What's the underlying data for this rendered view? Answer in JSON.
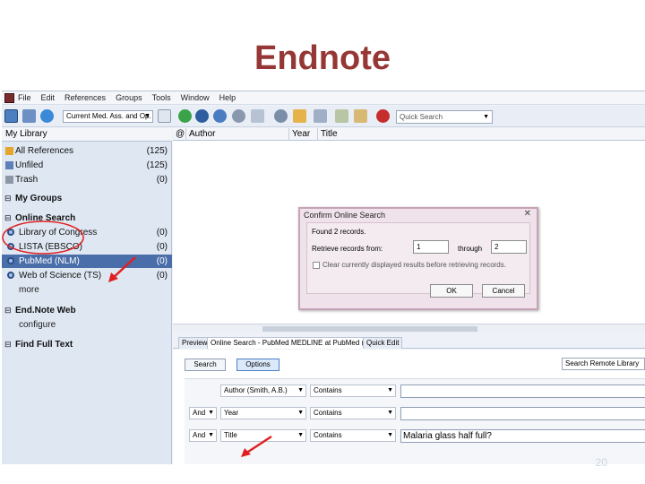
{
  "slide": {
    "title": "Endnote",
    "page_number": "20"
  },
  "menu": [
    "File",
    "Edit",
    "References",
    "Groups",
    "Tools",
    "Window",
    "Help"
  ],
  "toolbar": {
    "style_select": "Current Med. Ass. and Op. Ci.",
    "quick_search_placeholder": "Quick Search"
  },
  "left_pane": {
    "header": "My Library",
    "items": [
      {
        "label": "All References",
        "count": "(125)"
      },
      {
        "label": "Unfiled",
        "count": "(125)"
      },
      {
        "label": "Trash",
        "count": "(0)"
      }
    ],
    "my_groups": "My Groups",
    "online_search": {
      "title": "Online Search",
      "items": [
        {
          "label": "Library of Congress",
          "count": "(0)"
        },
        {
          "label": "LISTA (EBSCO)",
          "count": "(0)"
        },
        {
          "label": "PubMed (NLM)",
          "count": "(0)"
        },
        {
          "label": "Web of Science (TS)",
          "count": "(0)"
        }
      ],
      "more": "more"
    },
    "endnote_web": {
      "title": "End.Note Web",
      "configure": "configure"
    },
    "find_full_text": "Find Full Text"
  },
  "list": {
    "columns": [
      "Author",
      "Year",
      "Title"
    ]
  },
  "dialog": {
    "title": "Confirm Online Search",
    "close": "✕",
    "found": "Found 2 records.",
    "retrieve_label": "Retrieve records from:",
    "from": "1",
    "through_label": "through",
    "to": "2",
    "clear_label": "Clear currently displayed results before retrieving records.",
    "ok": "OK",
    "cancel": "Cancel"
  },
  "bottom": {
    "tabs": [
      "Preview",
      "Online Search - PubMed MEDLINE at PubMed (NLM)",
      "Quick Edit"
    ],
    "search_button": "Search",
    "options_button": "Options",
    "remote": "Search Remote Library",
    "rows": [
      {
        "bool": "",
        "field": "Author (Smith, A.B.)",
        "op": "Contains",
        "term": ""
      },
      {
        "bool": "And",
        "field": "Year",
        "op": "Contains",
        "term": ""
      },
      {
        "bool": "And",
        "field": "Title",
        "op": "Contains",
        "term": "Malaria glass half full?"
      }
    ]
  },
  "colors": {
    "title": "#953735",
    "selected_row": "#4a6ea9",
    "annotation": "#e02020"
  }
}
